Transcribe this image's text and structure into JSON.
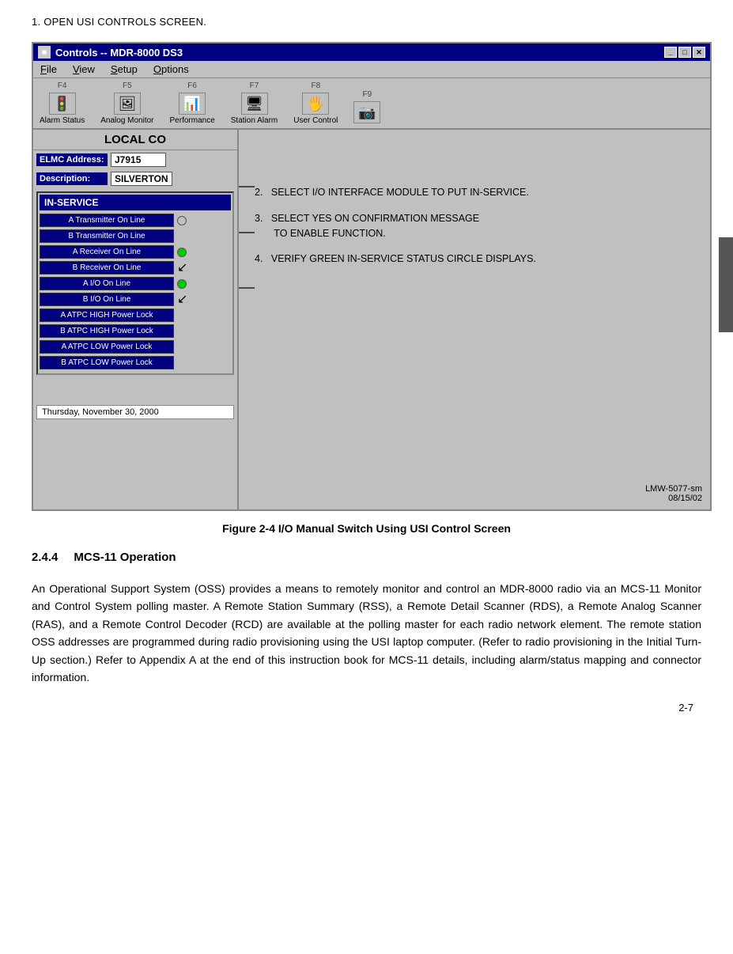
{
  "page": {
    "step1": "1.  OPEN USI CONTROLS SCREEN.",
    "figure_caption": "Figure 2-4  I/O Manual Switch Using USI Control Screen",
    "lmw_ref": "LMW-5077-sm\n08/15/02",
    "page_number": "2-7"
  },
  "window": {
    "title": "Controls -- MDR-8000 DS3",
    "title_icon": "■",
    "menu": {
      "items": [
        "File",
        "View",
        "Setup",
        "Options"
      ],
      "underlines": [
        0,
        0,
        0,
        0
      ]
    },
    "toolbar": [
      {
        "fkey": "F4",
        "label": "Alarm Status",
        "icon": "🚦"
      },
      {
        "fkey": "F5",
        "label": "Analog Monitor",
        "icon": "🖼"
      },
      {
        "fkey": "F6",
        "label": "Performance",
        "icon": "📊"
      },
      {
        "fkey": "F7",
        "label": "Station Alarm",
        "icon": "🖥"
      },
      {
        "fkey": "F8",
        "label": "User Control",
        "icon": "🖐"
      },
      {
        "fkey": "F9",
        "label": "",
        "icon": "📷"
      }
    ],
    "header_text": "LOCAL CO",
    "elmc_address_label": "ELMC Address:",
    "elmc_address_value": "J7915",
    "description_label": "Description:",
    "description_value": "SILVERTON",
    "inservice": {
      "title": "IN-SERVICE",
      "rows": [
        {
          "label": "A Transmitter On Line",
          "has_circle": true,
          "circle_type": "empty",
          "has_arrow": false
        },
        {
          "label": "B Transmitter On Line",
          "has_circle": false,
          "circle_type": "empty",
          "has_arrow": false
        },
        {
          "label": "A Receiver On Line",
          "has_circle": true,
          "circle_type": "green",
          "has_arrow": false
        },
        {
          "label": "B Receiver On Line",
          "has_circle": false,
          "circle_type": "empty",
          "has_arrow": true
        },
        {
          "label": "A I/O On Line",
          "has_circle": true,
          "circle_type": "green",
          "has_arrow": false
        },
        {
          "label": "B I/O On Line",
          "has_circle": false,
          "circle_type": "empty",
          "has_arrow": true
        },
        {
          "label": "A ATPC HIGH Power Lock",
          "has_circle": false,
          "circle_type": "empty",
          "has_arrow": false
        },
        {
          "label": "B ATPC HIGH Power Lock",
          "has_circle": false,
          "circle_type": "empty",
          "has_arrow": false
        },
        {
          "label": "A ATPC LOW Power Lock",
          "has_circle": false,
          "circle_type": "empty",
          "has_arrow": false
        },
        {
          "label": "B ATPC LOW Power Lock",
          "has_circle": false,
          "circle_type": "empty",
          "has_arrow": false
        }
      ]
    },
    "date_bar": "Thursday, November 30, 2000"
  },
  "instructions": [
    {
      "number": "2.",
      "text": "SELECT I/O INTERFACE MODULE TO PUT IN-SERVICE."
    },
    {
      "number": "3.",
      "text": "SELECT YES ON CONFIRMATION MESSAGE\n      TO ENABLE FUNCTION."
    },
    {
      "number": "4.",
      "text": "VERIFY GREEN IN-SERVICE STATUS CIRCLE DISPLAYS."
    }
  ],
  "section": {
    "number": "2.4.4",
    "title": "MCS-11 Operation",
    "body": "An Operational Support System (OSS) provides a means to remotely monitor and control an MDR-8000 radio via an MCS-11 Monitor and Control System polling master. A Remote Station Summary (RSS), a Remote Detail Scanner (RDS), a Remote Analog Scanner (RAS), and a Remote Control Decoder (RCD) are available at the polling master for each radio network element. The remote station OSS addresses are programmed during radio provisioning using the USI laptop computer. (Refer to radio provisioning in the Initial Turn-Up section.) Refer to Appendix A at the end of this instruction book for MCS-11 details, including alarm/status mapping and connector information."
  }
}
